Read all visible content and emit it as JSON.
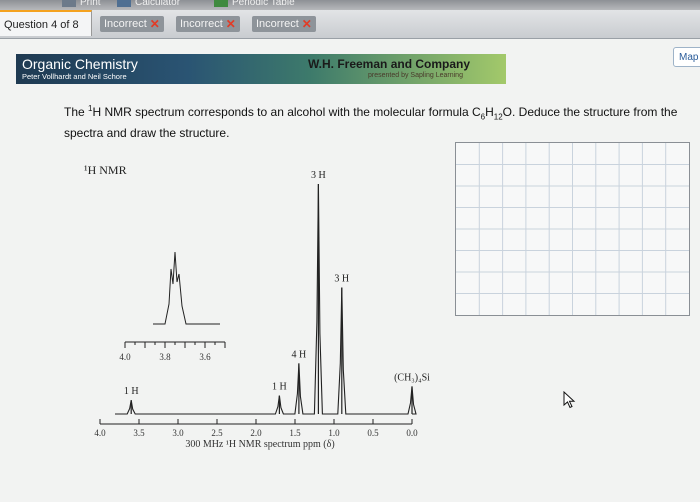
{
  "toolbar": {
    "print_label": "Print",
    "calculator_label": "Calculator",
    "periodic_table_label": "Periodic Table"
  },
  "question_bar": {
    "label": "Question 4 of 8",
    "attempts": [
      "Incorrect",
      "Incorrect",
      "Incorrect"
    ]
  },
  "banner": {
    "book_title": "Organic Chemistry",
    "book_authors": "Peter Vollhardt and Neil Schore",
    "publisher": "W.H. Freeman and Company",
    "publisher_sub": "presented by Sapling Learning"
  },
  "map_button": "Map",
  "question": {
    "pre": "The ",
    "sup": "1",
    "mid": "H NMR spectrum corresponds to an alcohol with the molecular formula C",
    "c_sub": "6",
    "h": "H",
    "h_sub": "12",
    "post": "O. Deduce the structure from the spectra and draw the structure."
  },
  "chart_data": {
    "type": "line",
    "title": "1H NMR",
    "xlabel": "300 MHz 1H NMR spectrum ppm (δ)",
    "xlim": [
      4.0,
      0.0
    ],
    "x_ticks": [
      "4.0",
      "3.5",
      "3.0",
      "2.5",
      "2.0",
      "1.5",
      "1.0",
      "0.5",
      "0.0"
    ],
    "inset_ticks": [
      "4.0",
      "3.8",
      "3.6"
    ],
    "peaks": [
      {
        "ppm": 3.6,
        "height": 0.06,
        "label": "1 H"
      },
      {
        "ppm": 1.7,
        "height": 0.08,
        "label": "1 H"
      },
      {
        "ppm": 1.45,
        "height": 0.22,
        "label": "4 H"
      },
      {
        "ppm": 1.2,
        "height": 1.0,
        "label": "3 H"
      },
      {
        "ppm": 0.9,
        "height": 0.55,
        "label": "3 H"
      },
      {
        "ppm": 0.0,
        "height": 0.12,
        "label": "(CH3)4Si"
      }
    ]
  }
}
